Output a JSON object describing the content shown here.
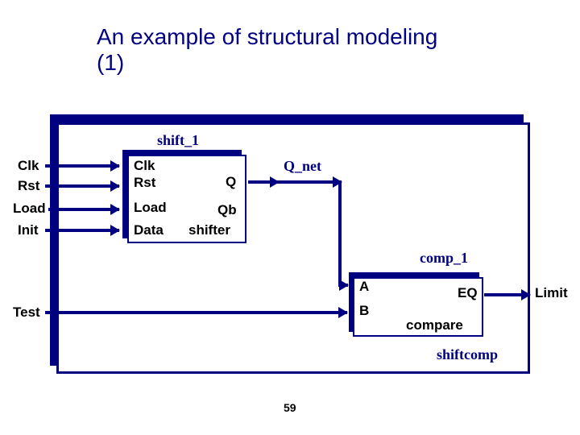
{
  "title": {
    "line1": "An example of structural modeling",
    "line2": "(1)"
  },
  "inputs": {
    "clk": "Clk",
    "rst": "Rst",
    "load": "Load",
    "init": "Init",
    "test": "Test"
  },
  "shifter": {
    "instance": "shift_1",
    "module": "shifter",
    "ports": {
      "clk": "Clk",
      "rst": "Rst",
      "load": "Load",
      "data": "Data",
      "q": "Q",
      "qb": "Qb"
    }
  },
  "net": {
    "q_net": "Q_net"
  },
  "compare": {
    "instance": "comp_1",
    "module": "compare",
    "ports": {
      "a": "A",
      "b": "B",
      "eq": "EQ"
    }
  },
  "top_module": "shiftcomp",
  "outputs": {
    "limit": "Limit"
  },
  "page": "59"
}
